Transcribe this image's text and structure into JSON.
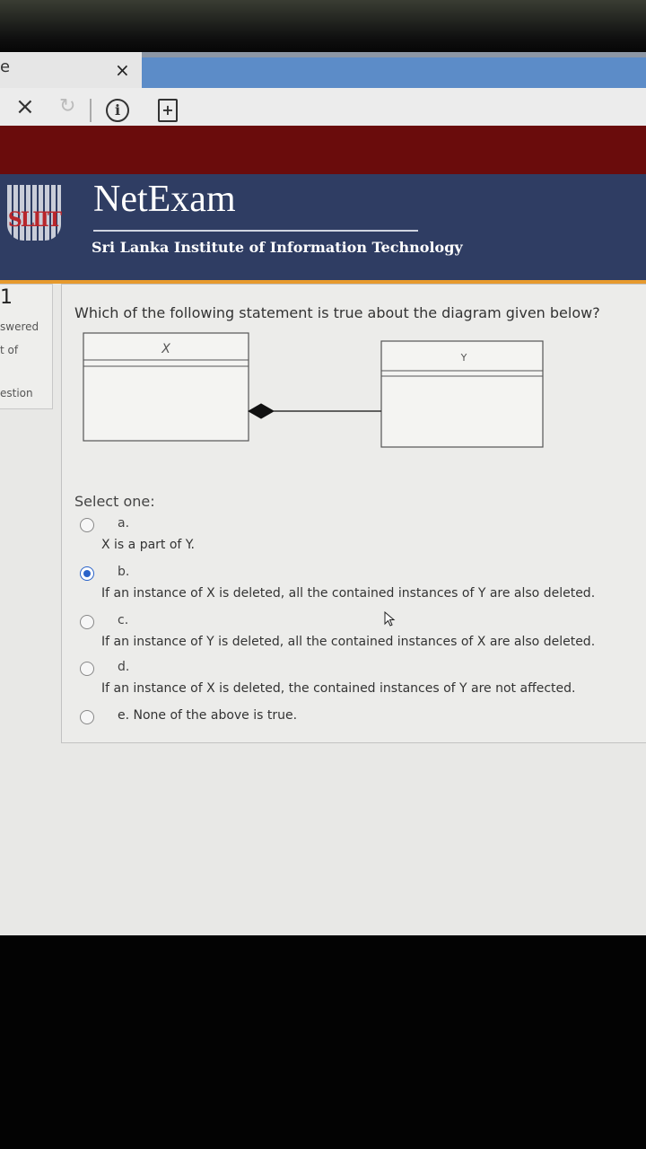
{
  "browser": {
    "tab_partial_text": "e",
    "tab_close": "×",
    "stop_icon": "close-icon",
    "refresh_icon": "refresh-icon",
    "info_icon": "info-icon",
    "add_icon": "add-page-icon",
    "stop_glyph": "×",
    "refresh_glyph": "↻",
    "info_glyph": "i",
    "add_glyph": "+"
  },
  "header": {
    "logo_text": "SLIIT",
    "brand": "NetExam",
    "subtitle": "Sri Lanka Institute of Information Technology"
  },
  "question_info": {
    "number": "1",
    "state": "swered",
    "mark": "t of",
    "flag": "estion"
  },
  "question": {
    "text": "Which of the following statement is true about the diagram given below?",
    "diagram": {
      "class_left": "X",
      "class_right": "Y"
    },
    "select_label": "Select one:",
    "options": [
      {
        "letter": "a.",
        "text": "X is a part of Y.",
        "selected": false
      },
      {
        "letter": "b.",
        "text": "If an instance of X is deleted, all the contained instances of Y are also deleted.",
        "selected": true
      },
      {
        "letter": "c.",
        "text": "If an instance of Y is deleted, all the contained instances of X are also deleted.",
        "selected": false
      },
      {
        "letter": "d.",
        "text": "If an instance of X is deleted, the contained instances of Y are not affected.",
        "selected": false
      },
      {
        "letter": "",
        "text": "e. None of the above is true.",
        "selected": false
      }
    ]
  },
  "colors": {
    "header_bg": "#2f3d63",
    "accent_orange": "#e79a2d",
    "dark_red": "#6a0c0c",
    "radio_selected": "#2a63c9"
  }
}
